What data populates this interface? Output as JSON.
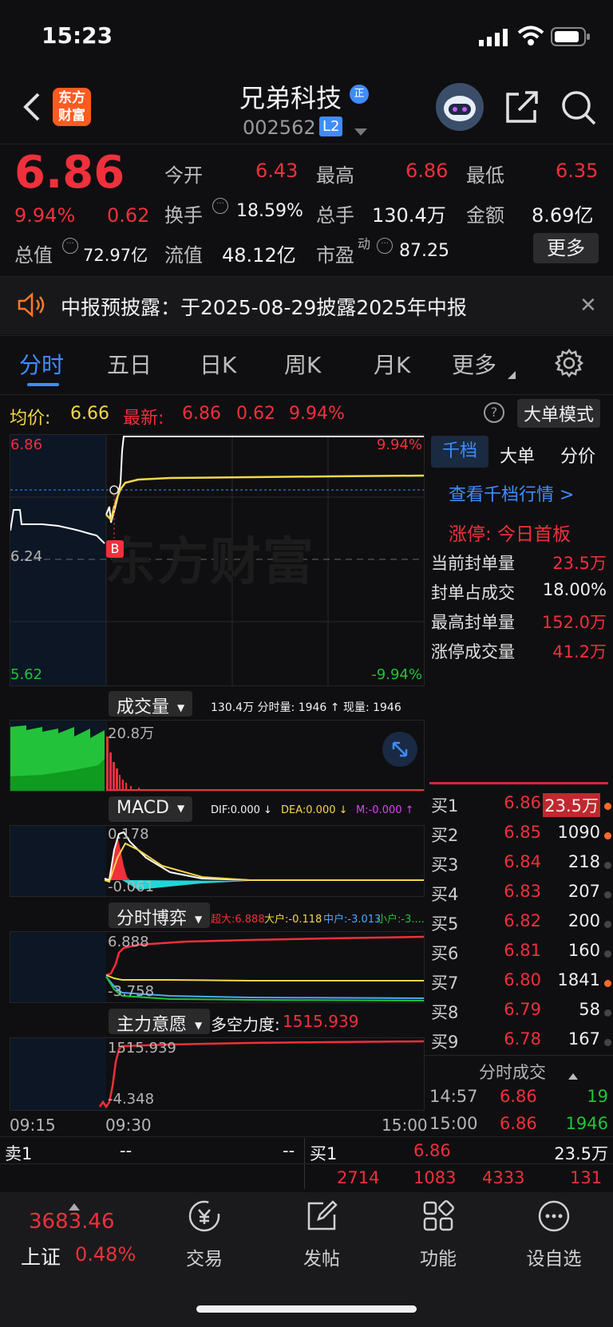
{
  "status_bar": {
    "time": "15:23"
  },
  "header": {
    "logo_line1": "东方",
    "logo_line2": "财富",
    "stock_name": "兄弟科技",
    "stock_code": "002562",
    "level_badge": "L2",
    "zheng_badge": "正"
  },
  "quote": {
    "price": "6.86",
    "change_pct": "9.94%",
    "change": "0.62",
    "open_label": "今开",
    "open": "6.43",
    "high_label": "最高",
    "high": "6.86",
    "low_label": "最低",
    "low": "6.35",
    "turnover_label": "换手",
    "turnover": "18.59%",
    "volume_label": "总手",
    "volume": "130.4万",
    "amount_label": "金额",
    "amount": "8.69亿",
    "mktcap_label": "总值",
    "mktcap": "72.97亿",
    "float_label": "流值",
    "float_cap": "48.12亿",
    "pe_label": "市盈",
    "pe_sup": "动",
    "pe": "87.25",
    "more_button": "更多"
  },
  "notice": {
    "text": "中报预披露：于2025-08-29披露2025年中报"
  },
  "tabs": [
    "分时",
    "五日",
    "日K",
    "周K",
    "月K",
    "更多"
  ],
  "info_bar": {
    "avg_label": "均价:",
    "avg": "6.66",
    "latest_label": "最新:",
    "latest": "6.86",
    "latest_change": "0.62",
    "latest_pct": "9.94%",
    "big_order_button": "大单模式"
  },
  "main_chart": {
    "top_price": "6.86",
    "mid_price": "6.24",
    "bottom_price": "5.62",
    "top_pct": "9.94%",
    "bottom_pct": "-9.94%",
    "watermark": "东方财富",
    "b_marker": "B"
  },
  "volume_chart": {
    "dropdown": "成交量",
    "stats": "130.4万 分时量: 1946 ↑ 现量: 1946",
    "max_label": "20.8万"
  },
  "macd_chart": {
    "dropdown": "MACD",
    "dif": "DIF:0.000 ↓",
    "dea": "DEA:0.000 ↓",
    "m": "M:-0.000 ↑",
    "top": "0.178",
    "bottom": "-0.061"
  },
  "game_chart": {
    "dropdown": "分时博弈",
    "super": "超大:6.888",
    "large": "大户:-0.118",
    "mid": "中户:-3.013",
    "small": "小户:-3....",
    "top": "6.888",
    "bottom": "-3.758"
  },
  "will_chart": {
    "dropdown": "主力意愿",
    "power_label": "多空力度:",
    "power": "1515.939",
    "top": "1515.939",
    "bottom": "-4.348"
  },
  "time_axis": {
    "t1": "09:15",
    "t2": "09:30",
    "t3": "15:00"
  },
  "side_panel": {
    "tabs": [
      "千档",
      "大单",
      "分价"
    ],
    "link": "查看千档行情 >",
    "limit_title": "涨停: 今日首板",
    "rows": [
      {
        "label": "当前封单量",
        "value": "23.5万"
      },
      {
        "label": "封单占成交",
        "value": "18.00%"
      },
      {
        "label": "最高封单量",
        "value": "152.0万"
      },
      {
        "label": "涨停成交量",
        "value": "41.2万"
      }
    ],
    "bids": [
      {
        "label": "买1",
        "price": "6.86",
        "vol": "23.5万",
        "dot": "#ff6a2a"
      },
      {
        "label": "买2",
        "price": "6.85",
        "vol": "1090",
        "dot": "#ff6a2a"
      },
      {
        "label": "买3",
        "price": "6.84",
        "vol": "218",
        "dot": "#444"
      },
      {
        "label": "买4",
        "price": "6.83",
        "vol": "207",
        "dot": "#444"
      },
      {
        "label": "买5",
        "price": "6.82",
        "vol": "200",
        "dot": "#444"
      },
      {
        "label": "买6",
        "price": "6.81",
        "vol": "160",
        "dot": "#444"
      },
      {
        "label": "买7",
        "price": "6.80",
        "vol": "1841",
        "dot": "#ff6a2a"
      },
      {
        "label": "买8",
        "price": "6.79",
        "vol": "58",
        "dot": "#444"
      },
      {
        "label": "买9",
        "price": "6.78",
        "vol": "167",
        "dot": "#444"
      }
    ],
    "ticks_title": "分时成交",
    "ticks": [
      {
        "time": "14:57",
        "price": "6.86",
        "vol": "19"
      },
      {
        "time": "15:00",
        "price": "6.86",
        "vol": "1946"
      }
    ]
  },
  "order_bar": {
    "sell_label": "卖1",
    "sell_price": "--",
    "sell_vol": "--",
    "buy_label": "买1",
    "buy_price": "6.86",
    "buy_vol": "23.5万",
    "queue": [
      "2714",
      "1083",
      "4333",
      "131"
    ]
  },
  "bottom_nav": {
    "index_value": "3683.46",
    "index_name": "上证",
    "index_pct": "0.48%",
    "items": [
      "交易",
      "发帖",
      "功能",
      "设自选"
    ]
  },
  "colors": {
    "up": "#f0303c",
    "down": "#22c33a",
    "accent": "#3f8cff",
    "avg_line": "#f4d74a"
  }
}
